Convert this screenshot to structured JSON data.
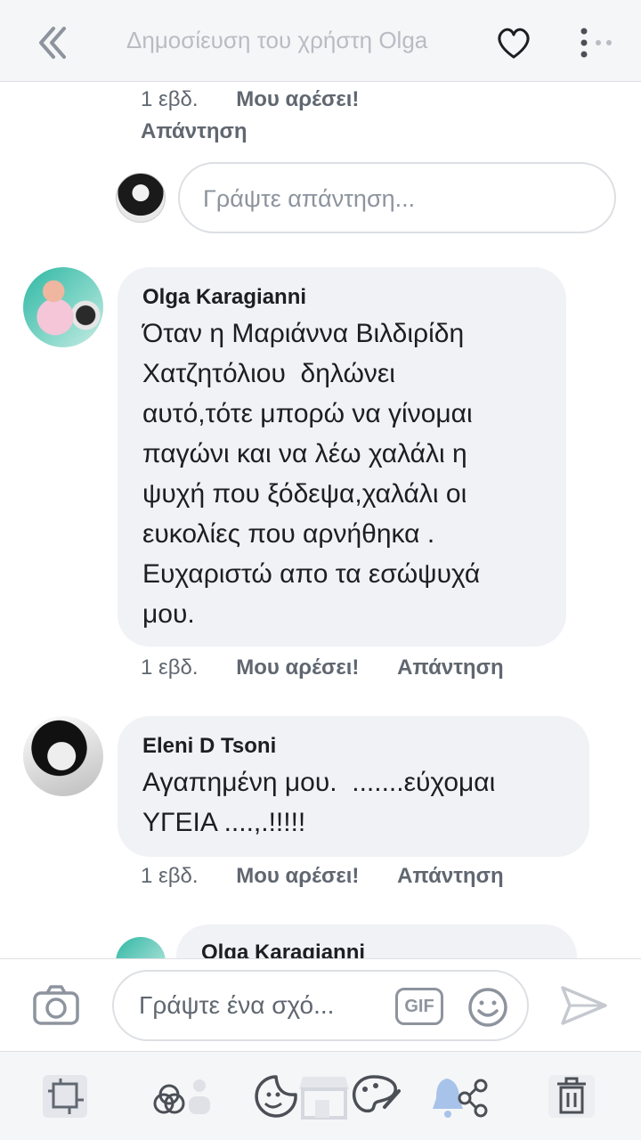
{
  "header": {
    "title": "Δημοσίευση του χρήστη Olga"
  },
  "reply_meta": {
    "time": "1 εβδ.",
    "like": "Μου αρέσει!",
    "reply": "Απάντηση"
  },
  "reply_input": {
    "placeholder": "Γράψτε απάντηση..."
  },
  "comments": [
    {
      "author": "Olga Karagianni",
      "text": "Όταν η Μαριάννα Βιλδιρίδη\nΧατζητόλιου  δηλώνει\nαυτό,τότε μπορώ να γίνομαι\nπαγώνι και να λέω χαλάλι η\nψυχή που ξόδεψα,χαλάλι οι\nευκολίες που αρνήθηκα .\nΕυχαριστώ απο τα εσώψυχά\nμου.",
      "time": "1 εβδ.",
      "like": "Μου αρέσει!",
      "reply": "Απάντηση"
    },
    {
      "author": "Eleni D Tsoni",
      "text": "Αγαπημένη μου.  .......εύχομαι\nΥΓΕΙΑ ....,.!!!!!",
      "time": "1 εβδ.",
      "like": "Μου αρέσει!",
      "reply": "Απάντηση"
    },
    {
      "author": "Olga Karagianni"
    }
  ],
  "composer": {
    "placeholder": "Γράψτε ένα σχό...",
    "gif_label": "GIF"
  },
  "tabbar": {
    "items": [
      "feed-icon",
      "groups-icon",
      "sticker-icon",
      "marketplace-icon",
      "palette-icon",
      "notifications-icon",
      "delete-icon"
    ]
  },
  "colors": {
    "bubble": "#f1f2f6",
    "meta": "#606770",
    "icon": "#8d949e",
    "accent": "#a8c3ea"
  }
}
